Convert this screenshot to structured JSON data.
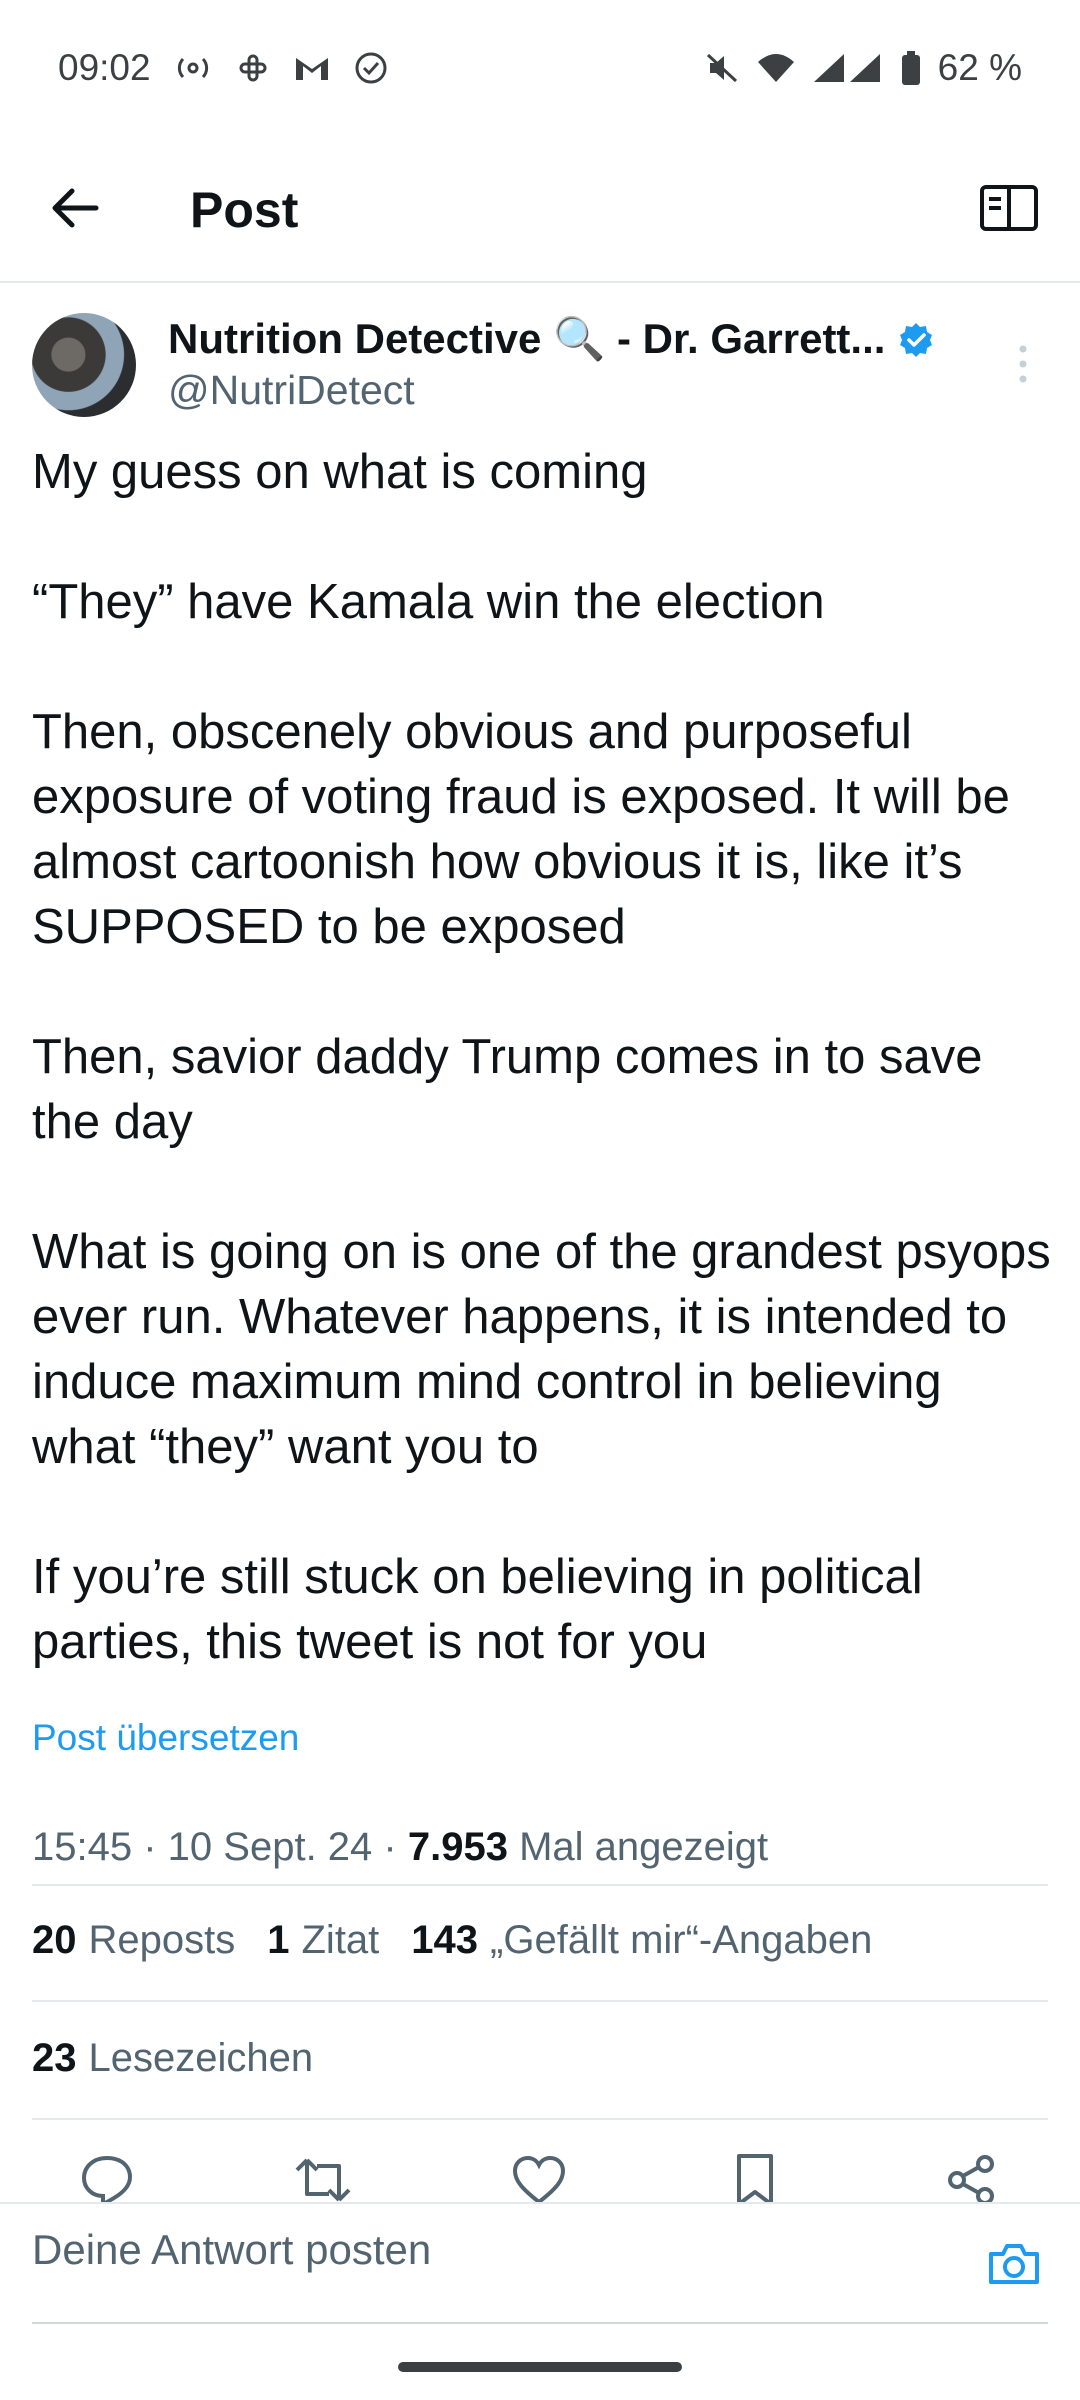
{
  "status_bar": {
    "time": "09:02",
    "left_icons": [
      "radio-icon",
      "slack-icon",
      "gmail-icon",
      "check-circle-icon"
    ],
    "right_icons": [
      "vibrate-off-icon",
      "wifi-icon",
      "signal-icon",
      "battery-icon"
    ],
    "battery": "62 %"
  },
  "topbar": {
    "title": "Post"
  },
  "post": {
    "author_name": "Nutrition Detective 🔍 - Dr. Garrett...",
    "author_handle": "@NutriDetect",
    "text": "My guess on what is coming\n\n“They” have Kamala win the election\n\nThen, obscenely obvious and purposeful exposure of voting fraud is exposed. It will be almost cartoonish how obvious it is, like it’s SUPPOSED to be exposed\n\nThen, savior daddy Trump comes in to save the day\n\nWhat is going on is one of the grandest psyops ever run. Whatever happens, it is intended to induce maximum mind control in believing what “they” want you to\n\nIf you’re still stuck on believing in political parties, this tweet is not for you",
    "translate_label": "Post übersetzen",
    "time": "15:45",
    "date": "10 Sept. 24",
    "views_count": "7.953",
    "views_label": "Mal angezeigt"
  },
  "stats": {
    "reposts_count": "20",
    "reposts_label": "Reposts",
    "quotes_count": "1",
    "quotes_label": "Zitat",
    "likes_count": "143",
    "likes_label": "„Gefällt mir“-Angaben",
    "bookmarks_count": "23",
    "bookmarks_label": "Lesezeichen"
  },
  "reply": {
    "placeholder": "Deine Antwort posten"
  },
  "colors": {
    "accent": "#1d9bf0",
    "text": "#0f1419",
    "secondary": "#536471",
    "divider": "#e6e9eb"
  }
}
